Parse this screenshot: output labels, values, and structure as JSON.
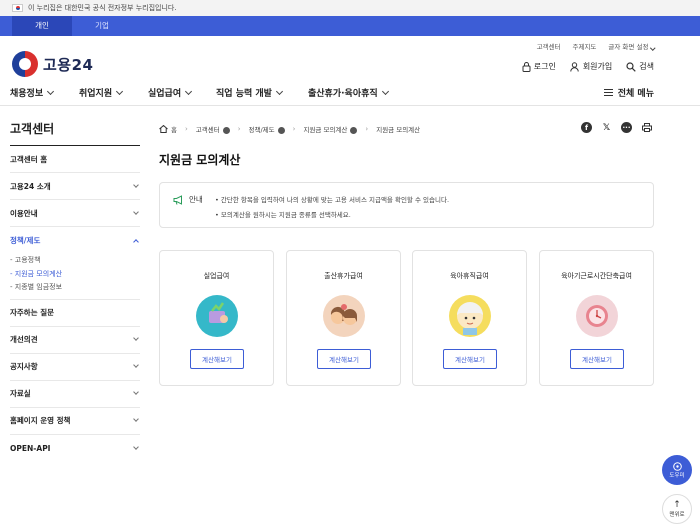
{
  "gov_banner": {
    "text": "이 누리집은 대한민국 공식 전자정부 누리집입니다."
  },
  "tabs": [
    {
      "label": "개인"
    },
    {
      "label": "기업"
    }
  ],
  "logo": {
    "text": "고용24"
  },
  "utils": [
    "고객센터",
    "주제지도",
    "글자 화면 설정"
  ],
  "actions": {
    "login": "로그인",
    "signup": "회원가입",
    "search": "검색"
  },
  "gnb": [
    "채용정보",
    "취업지원",
    "실업급여",
    "직업 능력 개발",
    "출산휴가·육아휴직"
  ],
  "all_menu": "전체 메뉴",
  "sidebar": {
    "title": "고객센터",
    "items": [
      {
        "label": "고객센터 홈"
      },
      {
        "label": "고용24 소개"
      },
      {
        "label": "이용안내"
      },
      {
        "label": "정책/제도"
      },
      {
        "label": "자주하는 질문"
      },
      {
        "label": "개선의견"
      },
      {
        "label": "공지사항"
      },
      {
        "label": "자료실"
      },
      {
        "label": "홈페이지 운영 정책"
      },
      {
        "label": "OPEN-API"
      }
    ],
    "subitems": [
      "- 고용정책",
      "- 지원금 모의계산",
      "- 지종별 임금정보"
    ]
  },
  "breadcrumb": [
    "홈",
    "고객센터",
    "정책/제도",
    "지원금 모의계산",
    "지원금 모의계산"
  ],
  "page_title": "지원금 모의계산",
  "notice": {
    "label": "안내",
    "lines": [
      "• 간단한 항목을 입력하여 나의 상황에 맞는 고용 서비스 지급액을 확인할 수 있습니다.",
      "• 모의계산을 원하시는 지원금 종류를 선택하세요."
    ]
  },
  "cards": [
    {
      "title": "실업급여",
      "button": "계산해보기",
      "color": "#35b8c9"
    },
    {
      "title": "출산휴가급여",
      "button": "계산해보기",
      "color": "#f3d4bd"
    },
    {
      "title": "육아휴직급여",
      "button": "계산해보기",
      "color": "#f5dd5e"
    },
    {
      "title": "육아기근로시간단축급여",
      "button": "계산해보기",
      "color": "#f2d4d8"
    }
  ],
  "floating": {
    "help": "도우미",
    "top": "맨위로"
  }
}
